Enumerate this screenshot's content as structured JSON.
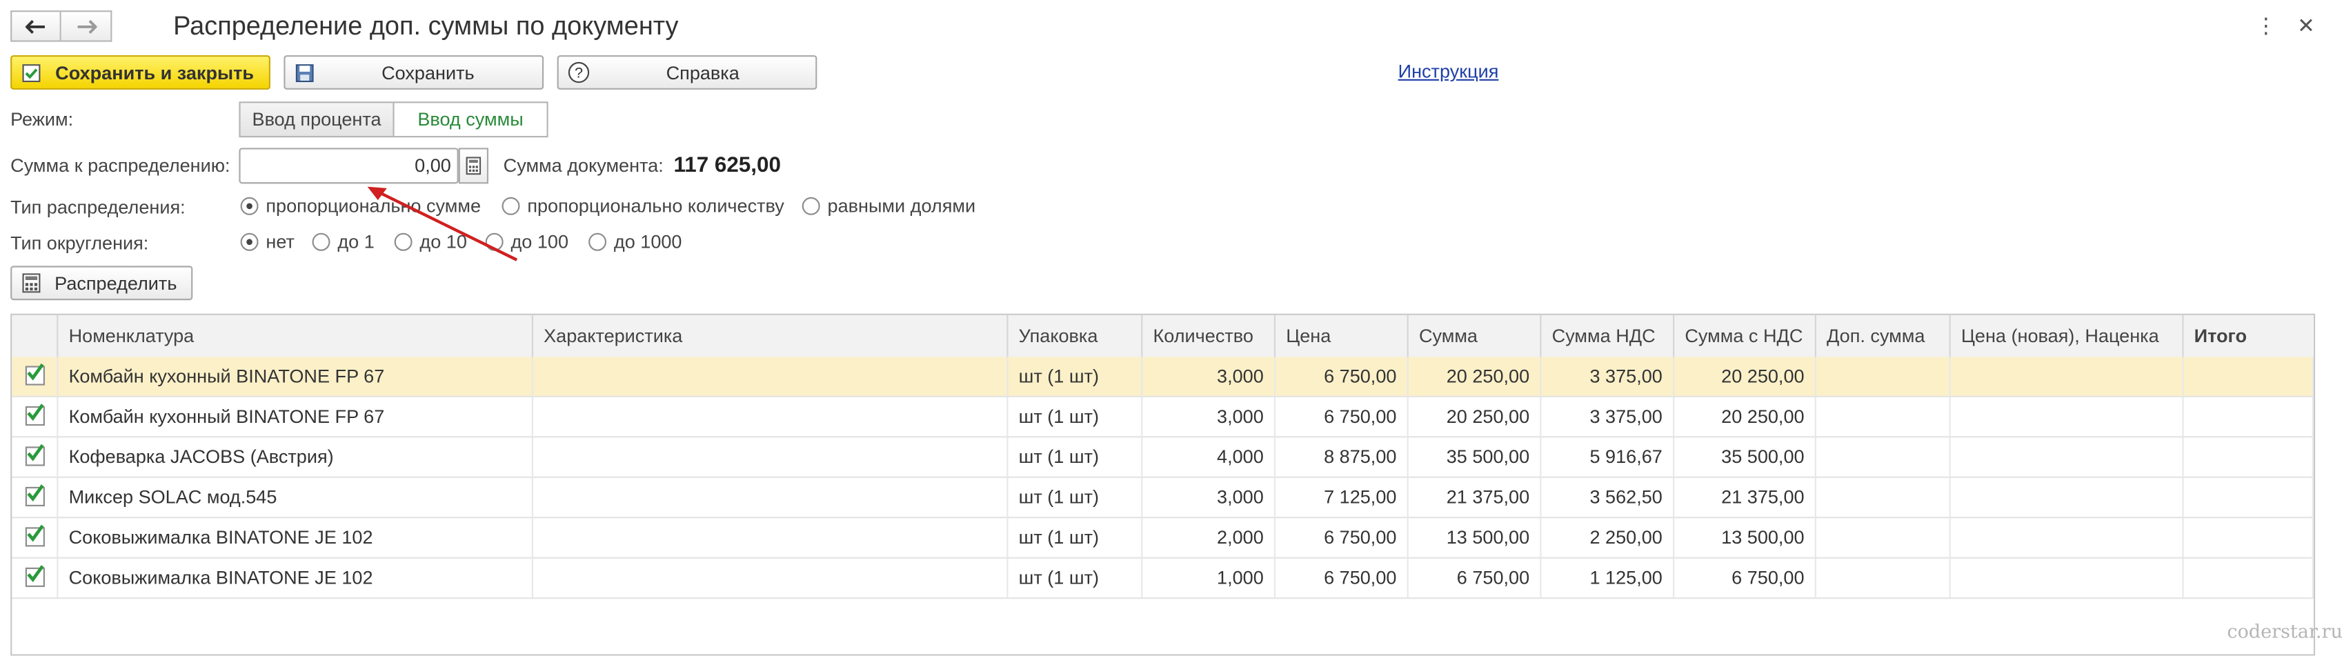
{
  "window": {
    "title": "Распределение доп. суммы по документу"
  },
  "toolbar": {
    "save_close_label": "Сохранить и закрыть",
    "save_label": "Сохранить",
    "help_label": "Справка",
    "instruction_link": "Инструкция"
  },
  "mode": {
    "label": "Режим:",
    "options": [
      "Ввод процента",
      "Ввод суммы"
    ],
    "selected": "Ввод суммы"
  },
  "amount": {
    "label": "Сумма к распределению:",
    "value": "0,00",
    "doc_sum_label": "Сумма документа:",
    "doc_sum_value": "117 625,00"
  },
  "distribution_type": {
    "label": "Тип распределения:",
    "options": [
      "пропорционально сумме",
      "пропорционально количеству",
      "равными долями"
    ],
    "selected": "пропорционально сумме"
  },
  "rounding_type": {
    "label": "Тип округления:",
    "options": [
      "нет",
      "до 1",
      "до 10",
      "до 100",
      "до 1000"
    ],
    "selected": "нет"
  },
  "distribute_button": "Распределить",
  "table": {
    "columns": [
      "Номенклатура",
      "Характеристика",
      "Упаковка",
      "Количество",
      "Цена",
      "Сумма",
      "Сумма НДС",
      "Сумма с НДС",
      "Доп. сумма",
      "Цена (новая), Наценка",
      "Итого"
    ],
    "rows": [
      {
        "checked": true,
        "item": "Комбайн кухонный BINATONE FP 67",
        "char": "",
        "pack": "шт (1 шт)",
        "qty": "3,000",
        "price": "6 750,00",
        "sum": "20 250,00",
        "vat": "3 375,00",
        "sum_vat": "20 250,00",
        "extra": "",
        "new_price": "",
        "total": ""
      },
      {
        "checked": true,
        "item": "Комбайн кухонный BINATONE FP 67",
        "char": "",
        "pack": "шт (1 шт)",
        "qty": "3,000",
        "price": "6 750,00",
        "sum": "20 250,00",
        "vat": "3 375,00",
        "sum_vat": "20 250,00",
        "extra": "",
        "new_price": "",
        "total": ""
      },
      {
        "checked": true,
        "item": "Кофеварка JACOBS (Австрия)",
        "char": "",
        "pack": "шт (1 шт)",
        "qty": "4,000",
        "price": "8 875,00",
        "sum": "35 500,00",
        "vat": "5 916,67",
        "sum_vat": "35 500,00",
        "extra": "",
        "new_price": "",
        "total": ""
      },
      {
        "checked": true,
        "item": "Миксер SOLAC мод.545",
        "char": "",
        "pack": "шт (1 шт)",
        "qty": "3,000",
        "price": "7 125,00",
        "sum": "21 375,00",
        "vat": "3 562,50",
        "sum_vat": "21 375,00",
        "extra": "",
        "new_price": "",
        "total": ""
      },
      {
        "checked": true,
        "item": "Соковыжималка  BINATONE JE 102",
        "char": "",
        "pack": "шт (1 шт)",
        "qty": "2,000",
        "price": "6 750,00",
        "sum": "13 500,00",
        "vat": "2 250,00",
        "sum_vat": "13 500,00",
        "extra": "",
        "new_price": "",
        "total": ""
      },
      {
        "checked": true,
        "item": "Соковыжималка  BINATONE JE 102",
        "char": "",
        "pack": "шт (1 шт)",
        "qty": "1,000",
        "price": "6 750,00",
        "sum": "6 750,00",
        "vat": "1 125,00",
        "sum_vat": "6 750,00",
        "extra": "",
        "new_price": "",
        "total": ""
      }
    ]
  },
  "watermark": "coderstar.ru",
  "colors": {
    "primary_button": "#f5d400",
    "selected_row": "#fbf0c8",
    "active_mode_text": "#2a8a3a",
    "checkmark": "#2a9a3a",
    "annotation_arrow": "#d02020",
    "link": "#1f3fa8"
  },
  "icons": [
    "back-arrow-icon",
    "forward-arrow-icon",
    "more-icon",
    "close-icon",
    "save-icon",
    "help-icon",
    "calculator-icon",
    "checkbox-icon"
  ]
}
